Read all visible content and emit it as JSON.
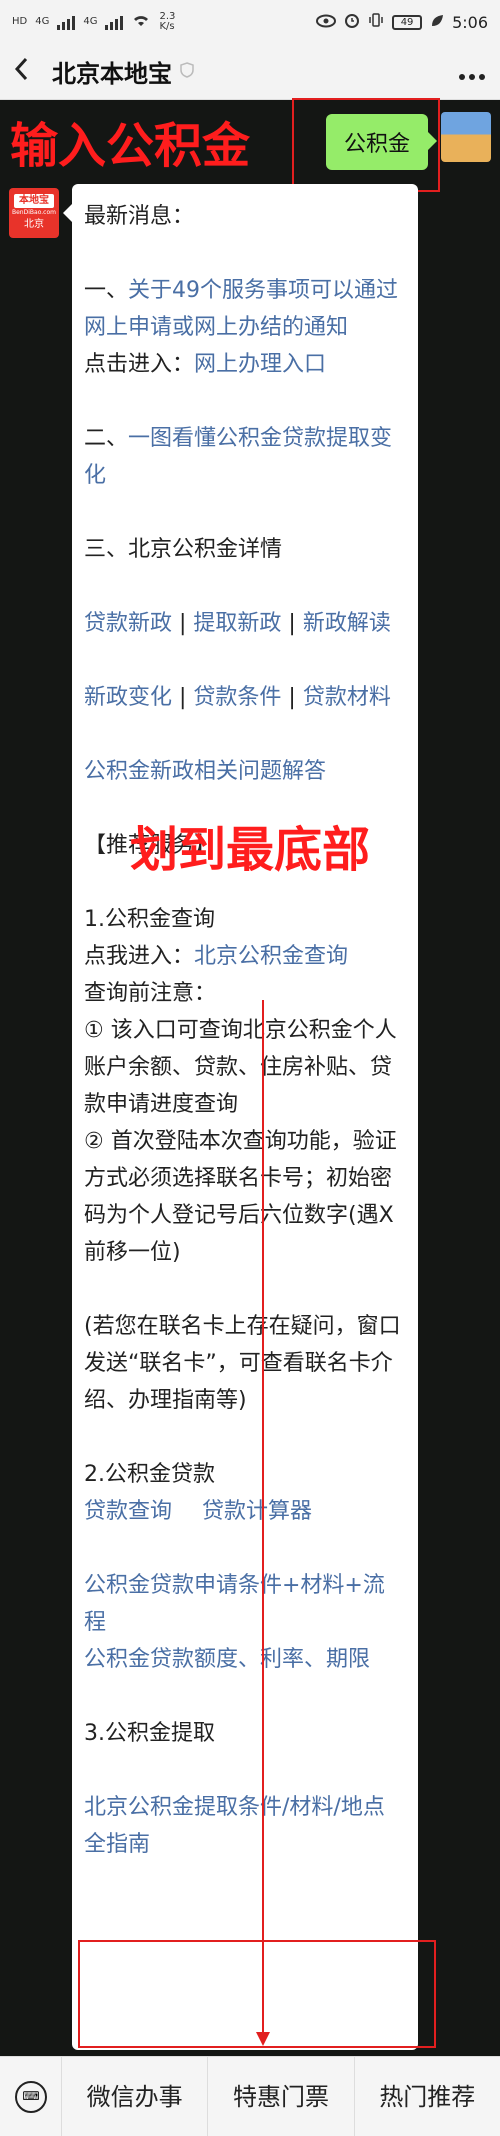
{
  "status": {
    "hd": "HD",
    "net1": "4G",
    "net2": "4G",
    "speed": "2.3\nK/s",
    "battery": "49",
    "time": "5:06"
  },
  "nav": {
    "back_icon": "chevron-left-icon",
    "title": "北京本地宝",
    "more_icon": "more-icon"
  },
  "annotations": {
    "top": "输入公积金",
    "middle": "划到最底部",
    "color": "#ff1d1d"
  },
  "sent_message": "公积金",
  "bot": {
    "avatar_top": "本地宝",
    "avatar_mid": "BenDiBao.com",
    "avatar_bottom": "北京"
  },
  "reply": {
    "intro": "最新消息：",
    "item1_prefix": "一、",
    "item1_link": "关于49个服务事项可以通过网上申请或网上办结的通知",
    "item1_click": "点击进入：",
    "item1_click_link": "网上办理入口",
    "item2_prefix": "二、",
    "item2_link": "一图看懂公积金贷款提取变化",
    "item3": "三、北京公积金详情",
    "links_row1": [
      "贷款新政",
      "提取新政",
      "新政解读"
    ],
    "links_row2": [
      "新政变化",
      "贷款条件",
      "贷款材料"
    ],
    "sep": " | ",
    "faq_link": "公积金新政相关问题解答",
    "services_title": "【推荐服务】",
    "s1_title": "1.公积金查询",
    "s1_enter": "点我进入：",
    "s1_link": "北京公积金查询",
    "s1_note_title": "查询前注意：",
    "s1_note1": "① 该入口可查询北京公积金个人账户余额、贷款、住房补贴、贷款申请进度查询",
    "s1_note2": "② 首次登陆本次查询功能，验证方式必须选择联名卡号；初始密码为个人登记号后六位数字(遇X前移一位)",
    "s1_note3": "(若您在联名卡上存在疑问，窗口发送“联名卡”，可查看联名卡介绍、办理指南等)",
    "s2_title": "2.公积金贷款",
    "s2_link1": "贷款查询",
    "s2_link2": "贷款计算器",
    "s2_link3": "公积金贷款申请条件+材料+流程",
    "s2_link4": "公积金贷款额度、利率、期限",
    "s3_title": "3.公积金提取",
    "s3_link": "北京公积金提取条件/材料/地点全指南"
  },
  "bottom_menu": {
    "keyboard_icon": "keyboard-icon",
    "items": [
      "微信办事",
      "特惠门票",
      "热门推荐"
    ]
  }
}
